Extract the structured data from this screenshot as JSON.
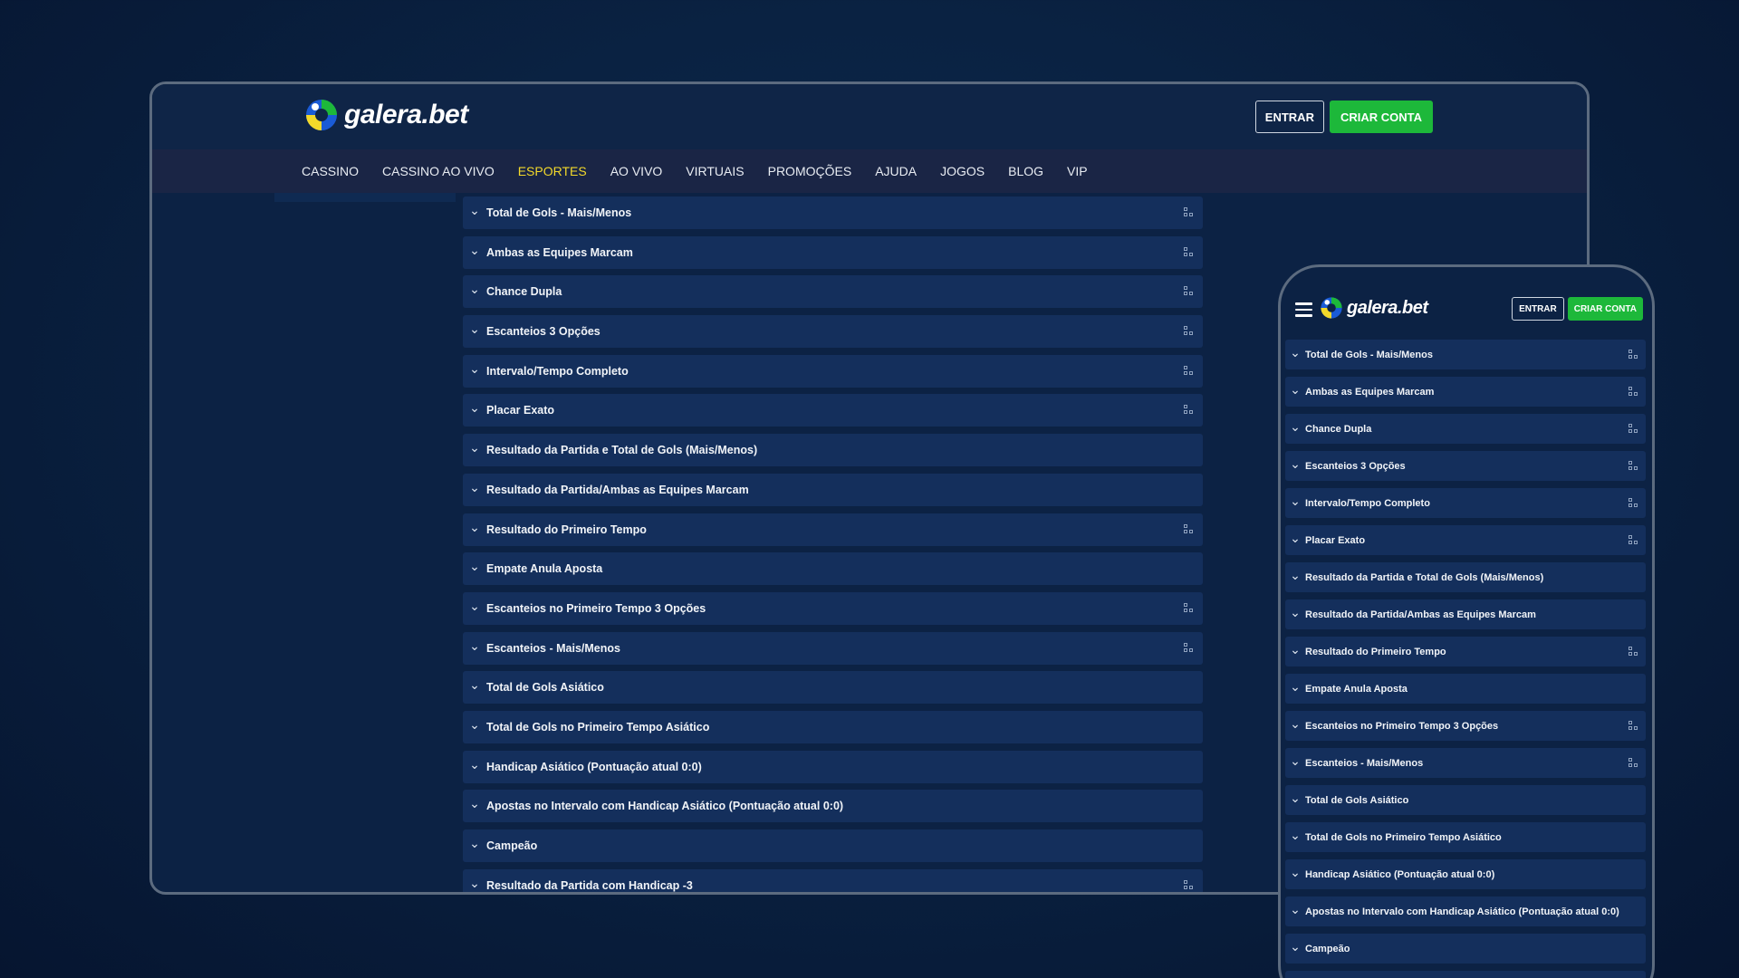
{
  "brand": {
    "name": "galera.bet",
    "colors": {
      "accent_green": "#1db83a",
      "active_nav": "#f3d92a",
      "row_bg": "#142f5c",
      "page_bg": "#0a2242"
    }
  },
  "header": {
    "login_label": "ENTRAR",
    "signup_label": "CRIAR CONTA"
  },
  "nav": {
    "items": [
      "CASSINO",
      "CASSINO AO VIVO",
      "ESPORTES",
      "AO VIVO",
      "VIRTUAIS",
      "PROMOÇÕES",
      "AJUDA",
      "JOGOS",
      "BLOG",
      "VIP"
    ],
    "active": "ESPORTES"
  },
  "markets": [
    {
      "label": "Total de Gols - Mais/Menos",
      "pin": true
    },
    {
      "label": "Ambas as Equipes Marcam",
      "pin": true
    },
    {
      "label": "Chance Dupla",
      "pin": true
    },
    {
      "label": "Escanteios 3 Opções",
      "pin": true
    },
    {
      "label": "Intervalo/Tempo Completo",
      "pin": true
    },
    {
      "label": "Placar Exato",
      "pin": true
    },
    {
      "label": "Resultado da Partida e Total de Gols (Mais/Menos)",
      "pin": false
    },
    {
      "label": "Resultado da Partida/Ambas as Equipes Marcam",
      "pin": false
    },
    {
      "label": "Resultado do Primeiro Tempo",
      "pin": true
    },
    {
      "label": "Empate Anula Aposta",
      "pin": false
    },
    {
      "label": "Escanteios no Primeiro Tempo 3 Opções",
      "pin": true
    },
    {
      "label": "Escanteios - Mais/Menos",
      "pin": true
    },
    {
      "label": "Total de Gols Asiático",
      "pin": false
    },
    {
      "label": "Total de Gols no Primeiro Tempo Asiático",
      "pin": false
    },
    {
      "label": "Handicap Asiático (Pontuação atual 0:0)",
      "pin": false
    },
    {
      "label": "Apostas no Intervalo com Handicap Asiático (Pontuação atual 0:0)",
      "pin": false
    },
    {
      "label": "Campeão",
      "pin": false
    },
    {
      "label": "Resultado da Partida com Handicap -3",
      "pin": true
    }
  ],
  "icons": {
    "expand": "chevron-down-icon",
    "pin": "pin-grid-icon",
    "menu": "hamburger-menu-icon",
    "logo": "galera-logo-icon"
  }
}
